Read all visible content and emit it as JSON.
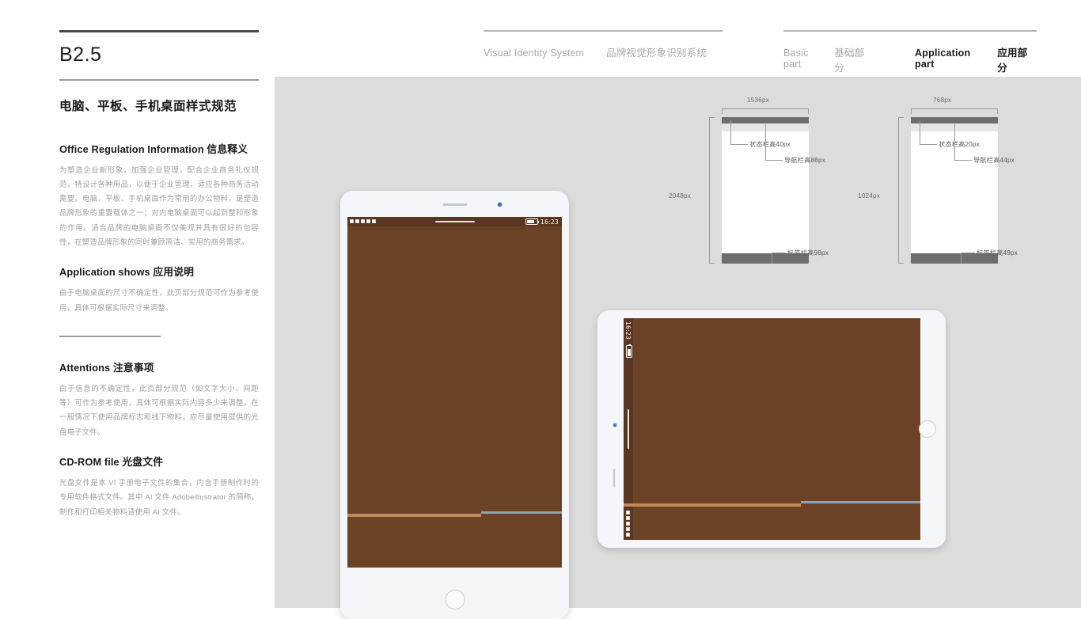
{
  "header": {
    "groups": [
      {
        "items": [
          {
            "en": "Visual Identity System",
            "cn": "品牌视觉形象识别系统"
          }
        ]
      },
      {
        "items": [
          {
            "en": "Basic part",
            "cn": "基础部分"
          },
          {
            "en": "Application part",
            "cn": "应用部分"
          }
        ]
      }
    ]
  },
  "sidebar": {
    "page_code": "B2.5",
    "page_title": "电脑、平板、手机桌面样式规范",
    "sections": [
      {
        "heading": "Office Regulation Information 信息释义",
        "body": "为塑造企业新形象，加强企业管理，配合企业商务礼仪规范，特设计各种用品，以便于企业管理，适应各种商务活动需要。电脑、平板、手机桌面作为常用的办公物料，是塑造品牌形象的重要载体之一；对内电脑桌面可以起到整和形象的作用。适合品牌的电脑桌面不仅美观并具有很好的包容性，在塑造品牌形象的同时兼顾简洁、实用的商务需求。"
      },
      {
        "heading": "Application shows 应用说明",
        "body": "由于电脑桌面的尺寸不确定性，此页部分规范可作为参考使用，具体可根据实际尺寸来调整。"
      },
      {
        "heading": "Attentions 注意事项",
        "body": "由于信息的不确定性，此页部分规范（如文字大小、间距等）可作为参考使用，具体可根据实际内容多少来调整。在一般情况下使用品牌标志和线下物料，应尽量使用提供的光盘电子文件。"
      },
      {
        "heading": "CD-ROM file 光盘文件",
        "body": "光盘文件是本 VI 手册电子文件的集合，内含手册制作时的专用软件格式文件。其中 AI 文件 Adobeillustrator 的简称，制作和打印相关物料请使用 AI 文件。"
      }
    ]
  },
  "specs": [
    {
      "id": "spec-large",
      "width_label": "1536px",
      "height_label": "2048px",
      "annotations": [
        {
          "key": "statusbar",
          "label": "状态栏高40px"
        },
        {
          "key": "navbar",
          "label": "导航栏高88px"
        },
        {
          "key": "tabbar",
          "label": "标签栏高98px"
        }
      ]
    },
    {
      "id": "spec-small",
      "width_label": "768px",
      "height_label": "1024px",
      "annotations": [
        {
          "key": "statusbar",
          "label": "状态栏高20px"
        },
        {
          "key": "navbar",
          "label": "导航栏高44px"
        },
        {
          "key": "tabbar",
          "label": "标签栏高49px"
        }
      ]
    }
  ],
  "devices": {
    "portrait_tablet": {
      "status_time": "16:23",
      "screen_color": "#6b4226"
    },
    "landscape_tablet": {
      "status_time": "16:23",
      "screen_color": "#6b4226"
    }
  },
  "colors": {
    "screen_brown": "#6b4226",
    "stage_gray": "#dcdcdc",
    "divider_tan": "#c08a5e",
    "divider_blue": "#8fa3b0",
    "spec_bar_gray": "#6e6e6e",
    "spec_nav_gray": "#e6e6e6"
  }
}
